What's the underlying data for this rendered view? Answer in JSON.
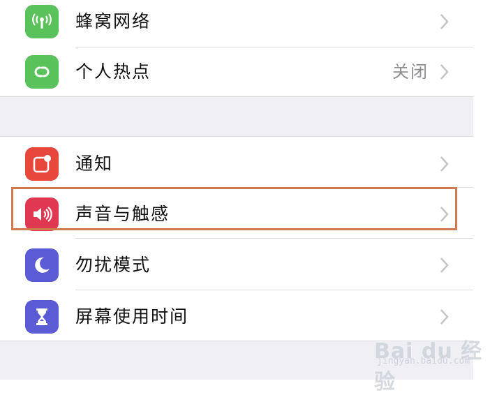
{
  "colors": {
    "cellular_icon_bg": "#5ac25a",
    "hotspot_icon_bg": "#5ac25a",
    "notifications_icon_bg": "#e8473c",
    "sounds_icon_bg": "#e03752",
    "dnd_icon_bg": "#5b5bd6",
    "screen_time_icon_bg": "#5b5bd6",
    "highlight_border": "#d07a4d",
    "group_gap_bg": "#efeff4"
  },
  "groups": [
    {
      "rows": [
        {
          "label": "蜂窝网络",
          "icon": "antenna-icon",
          "value": ""
        },
        {
          "label": "个人热点",
          "icon": "link-chain-icon",
          "value": "关闭"
        }
      ]
    },
    {
      "rows": [
        {
          "label": "通知",
          "icon": "notification-badge-icon",
          "value": ""
        },
        {
          "label": "声音与触感",
          "icon": "speaker-icon",
          "value": "",
          "highlighted": true
        },
        {
          "label": "勿扰模式",
          "icon": "moon-icon",
          "value": ""
        },
        {
          "label": "屏幕使用时间",
          "icon": "hourglass-icon",
          "value": ""
        }
      ]
    }
  ],
  "watermark": {
    "logo_text": "Bai du 经验",
    "url_text": "jingyan.baidu.com",
    "bottom_text": "..."
  }
}
